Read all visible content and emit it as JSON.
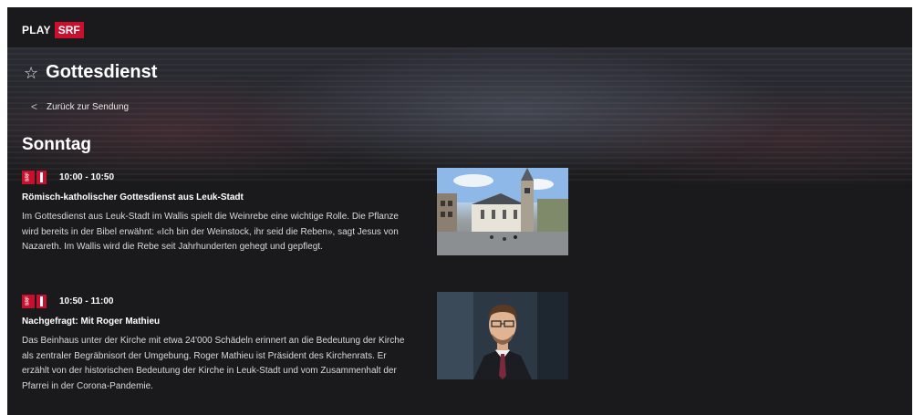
{
  "header": {
    "logo_play": "PLAY",
    "logo_srf": "SRF"
  },
  "page": {
    "title": "Gottesdienst",
    "star_icon": "star-outline-icon"
  },
  "back": {
    "label": "Zurück zur Sendung",
    "icon": "chevron-left-icon"
  },
  "schedule": {
    "day": "Sonntag",
    "episodes": [
      {
        "channel": "SRF 1",
        "time": "10:00 - 10:50",
        "title": "Römisch-katholischer Gottesdienst aus Leuk-Stadt",
        "description": "Im Gottesdienst aus Leuk-Stadt im Wallis spielt die Weinrebe eine wichtige Rolle. Die Pflanze wird bereits in der Bibel erwähnt: «Ich bin der Weinstock, ihr seid die Reben», sagt Jesus von Nazareth. Im Wallis wird die Rebe seit Jahrhunderten gehegt und gepflegt."
      },
      {
        "channel": "SRF 1",
        "time": "10:50 - 11:00",
        "title": "Nachgefragt: Mit Roger Mathieu",
        "description": "Das Beinhaus unter der Kirche mit etwa 24'000 Schädeln erinnert an die Bedeutung der Kirche als zentraler Begräbnisort der Umgebung. Roger Mathieu ist Präsident des Kirchenrats. Er erzählt von der historischen Bedeutung der Kirche in Leuk-Stadt und vom Zusammenhalt der Pfarrei in der Corona-Pandemie."
      }
    ]
  },
  "colors": {
    "brand_red": "#c8102e",
    "background": "#1a1a1c"
  }
}
